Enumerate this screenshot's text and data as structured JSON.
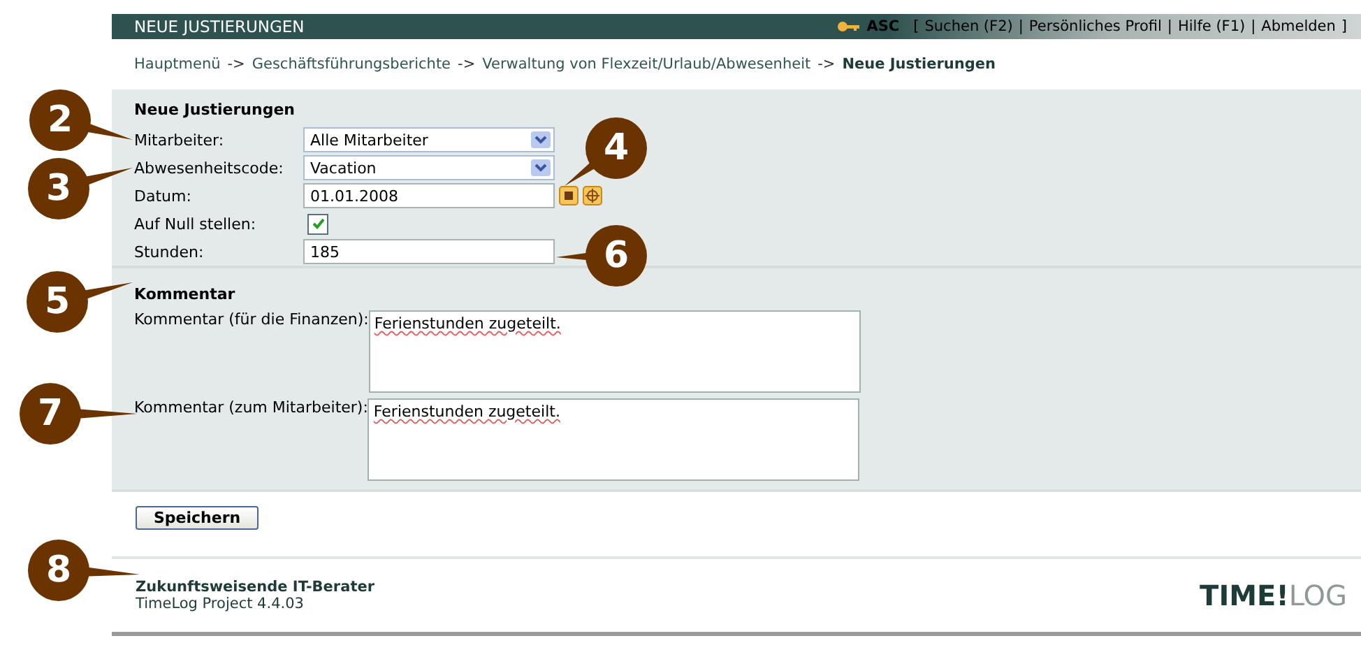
{
  "header": {
    "title": "NEUE JUSTIERUNGEN",
    "user": "ASC",
    "open": "[",
    "close": "]",
    "separator": "|",
    "links": [
      "Suchen (F2)",
      "Persönliches Profil",
      "Hilfe (F1)",
      "Abmelden"
    ]
  },
  "breadcrumb": {
    "separator": "->",
    "items": [
      {
        "label": "Hauptmenü",
        "current": false
      },
      {
        "label": "Geschäftsführungsberichte",
        "current": false
      },
      {
        "label": "Verwaltung von Flexzeit/Urlaub/Abwesenheit",
        "current": false
      },
      {
        "label": "Neue Justierungen",
        "current": true
      }
    ]
  },
  "form": {
    "title": "Neue Justierungen",
    "fields": [
      {
        "kind": "select",
        "label": "Mitarbeiter:",
        "value": "Alle Mitarbeiter"
      },
      {
        "kind": "select",
        "label": "Abwesenheitscode:",
        "value": "Vacation"
      },
      {
        "kind": "date",
        "label": "Datum:",
        "value": "01.01.2008"
      },
      {
        "kind": "checkbox",
        "label": "Auf Null stellen:",
        "checked": true
      },
      {
        "kind": "text",
        "label": "Stunden:",
        "value": "185"
      }
    ]
  },
  "comments": {
    "title": "Kommentar",
    "fields": [
      {
        "label": "Kommentar (für die Finanzen):",
        "value": "Ferienstunden zugeteilt."
      },
      {
        "label": "Kommentar (zum Mitarbeiter):",
        "value": "Ferienstunden zugeteilt."
      }
    ]
  },
  "save_button": "Speichern",
  "footer": {
    "company": "Zukunftsweisende IT-Berater",
    "version": "TimeLog Project 4.4.03",
    "logo_main": "TIME!",
    "logo_accent": "LOG"
  },
  "callouts": [
    "2",
    "3",
    "4",
    "5",
    "6",
    "7",
    "8"
  ]
}
